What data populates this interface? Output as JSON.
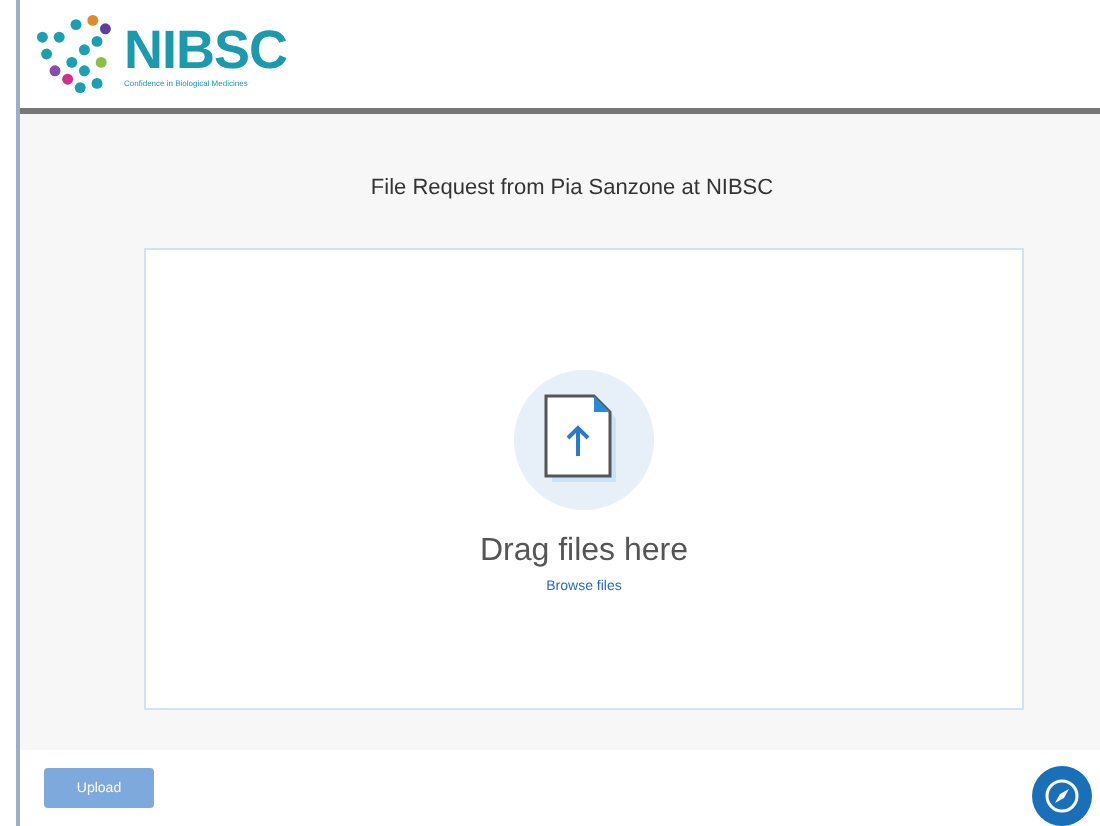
{
  "header": {
    "logo_text": "NIBSC",
    "logo_tagline": "Confidence in Biological Medicines"
  },
  "request_title": "File Request from Pia Sanzone at NIBSC",
  "dropzone": {
    "prompt": "Drag files here",
    "browse_link": "Browse files"
  },
  "upload_button": {
    "label": "Upload",
    "disabled": true
  }
}
